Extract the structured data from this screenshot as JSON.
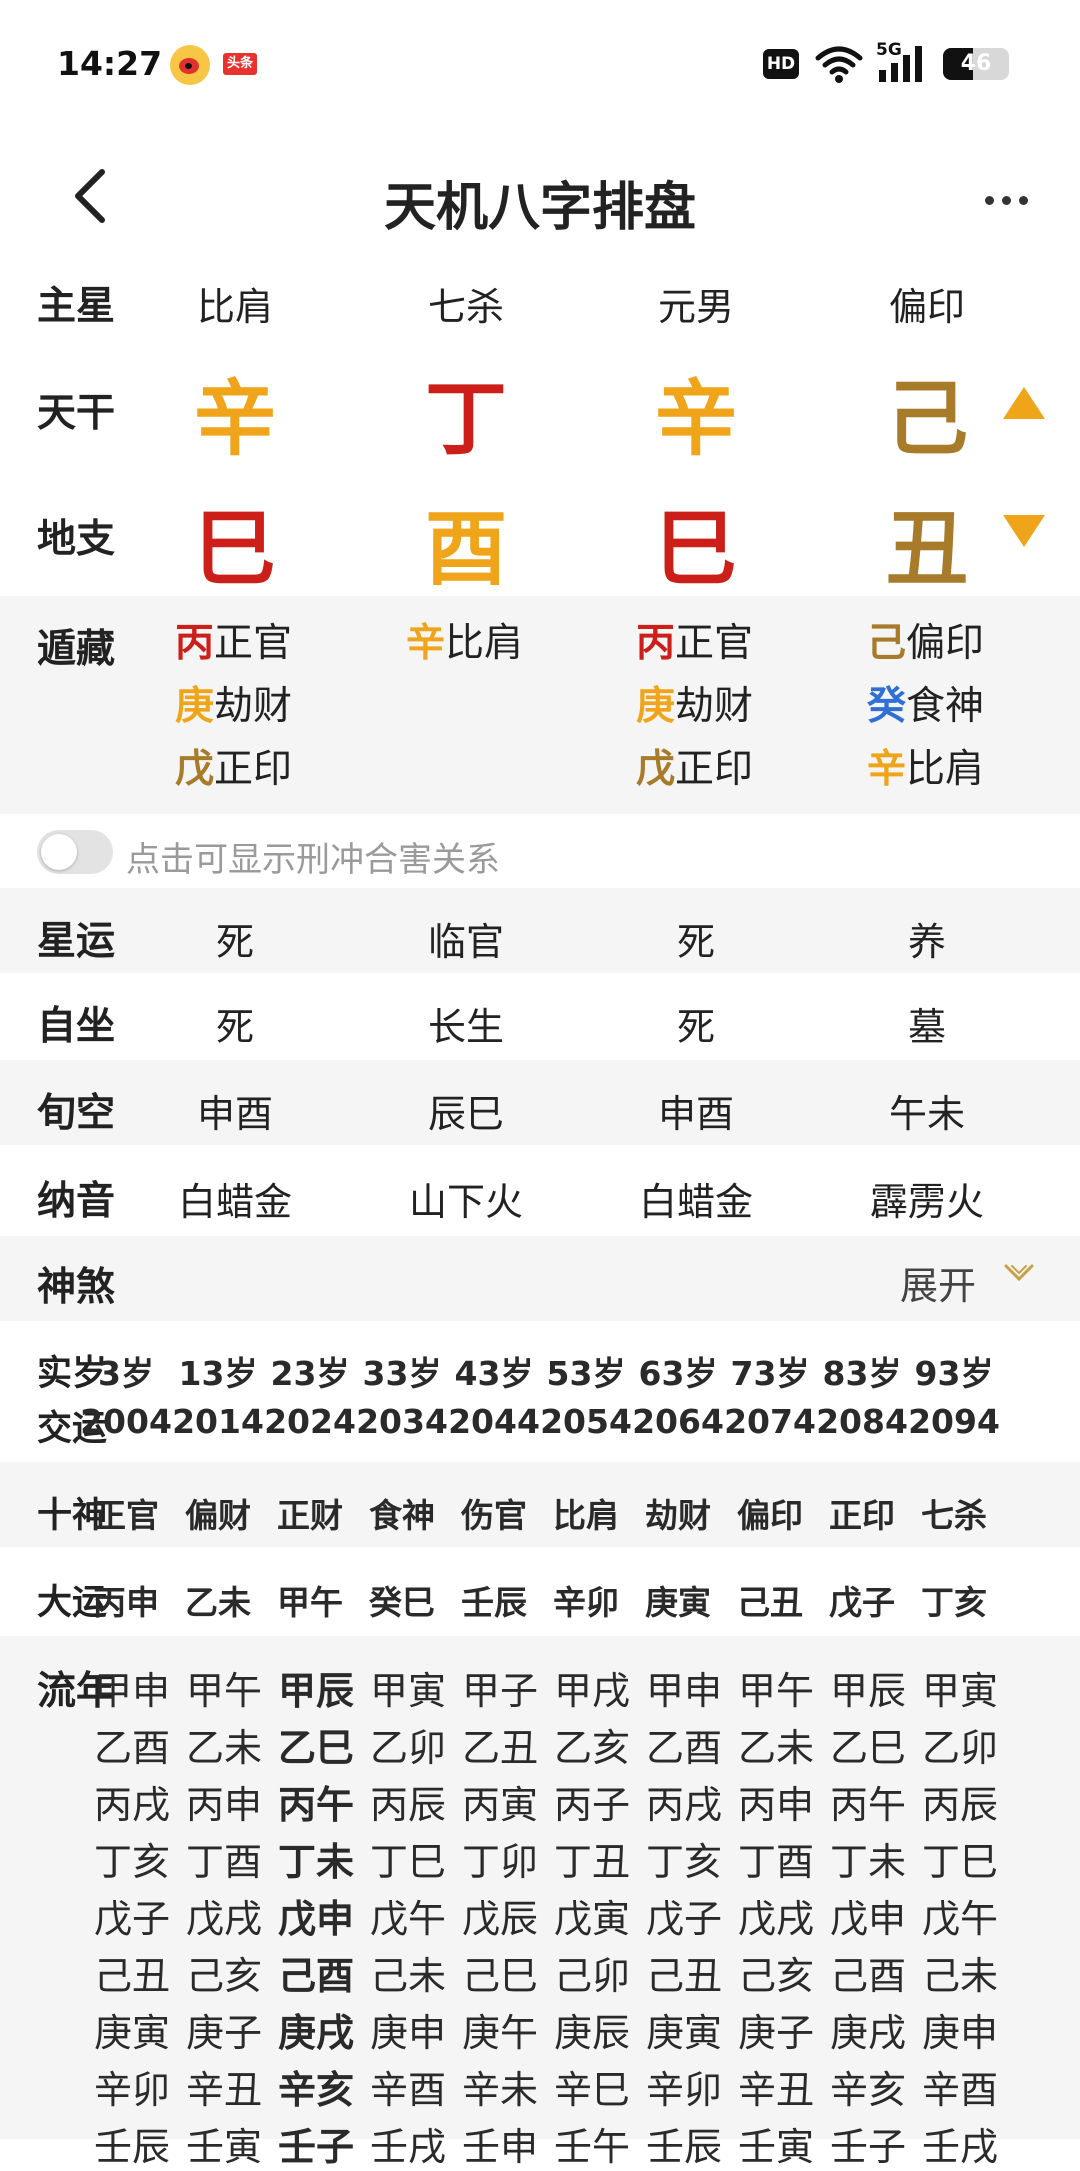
{
  "status": {
    "time": "14:27",
    "toutiao": "头条",
    "hd": "HD",
    "network": "5G",
    "battery_level": "46",
    "battery_fraction": 0.46
  },
  "nav": {
    "title": "天机八字排盘",
    "back_icon": "chevron-left-icon",
    "more_icon": "more-dots-icon"
  },
  "colors": {
    "red": "#cc1f1a",
    "orange": "#f0a419",
    "brown": "#a77b2a",
    "blue": "#2f6fd6",
    "band": "#f5f5f5"
  },
  "labels": {
    "zhuxing": "主星",
    "tiangan": "天干",
    "dizhi": "地支",
    "canggan": "遁藏",
    "xingyun": "星运",
    "zizuo": "自坐",
    "xunkong": "旬空",
    "nayin": "纳音",
    "shensha": "神煞",
    "shisui": "实岁",
    "jiaoyun": "交运",
    "shishen": "十神",
    "dayun": "大运",
    "liunian": "流年"
  },
  "zhuxing": [
    "比肩",
    "七杀",
    "元男",
    "偏印"
  ],
  "tiangan": [
    {
      "char": "辛",
      "color": "orange"
    },
    {
      "char": "丁",
      "color": "red"
    },
    {
      "char": "辛",
      "color": "orange"
    },
    {
      "char": "己",
      "color": "brown"
    }
  ],
  "dizhi": [
    {
      "char": "巳",
      "color": "red"
    },
    {
      "char": "酉",
      "color": "orange"
    },
    {
      "char": "巳",
      "color": "red"
    },
    {
      "char": "丑",
      "color": "brown"
    }
  ],
  "canggan": [
    [
      {
        "stem": "丙",
        "color": "red",
        "god": "正官"
      },
      {
        "stem": "庚",
        "color": "orange",
        "god": "劫财"
      },
      {
        "stem": "戊",
        "color": "brown",
        "god": "正印"
      }
    ],
    [
      {
        "stem": "辛",
        "color": "orange",
        "god": "比肩"
      }
    ],
    [
      {
        "stem": "丙",
        "color": "red",
        "god": "正官"
      },
      {
        "stem": "庚",
        "color": "orange",
        "god": "劫财"
      },
      {
        "stem": "戊",
        "color": "brown",
        "god": "正印"
      }
    ],
    [
      {
        "stem": "己",
        "color": "brown",
        "god": "偏印"
      },
      {
        "stem": "癸",
        "color": "blue",
        "god": "食神"
      },
      {
        "stem": "辛",
        "color": "orange",
        "god": "比肩"
      }
    ]
  ],
  "toggle": {
    "label": "点击可显示刑冲合害关系",
    "on": false
  },
  "xingyun": [
    "死",
    "临官",
    "死",
    "养"
  ],
  "zizuo": [
    "死",
    "长生",
    "死",
    "墓"
  ],
  "xunkong": [
    "申酉",
    "辰巳",
    "申酉",
    "午未"
  ],
  "nayin": [
    "白蜡金",
    "山下火",
    "白蜡金",
    "霹雳火"
  ],
  "shensha": {
    "expand_label": "展开",
    "icon": "chevron-down-icon"
  },
  "shisui": [
    "3岁",
    "13岁",
    "23岁",
    "33岁",
    "43岁",
    "53岁",
    "63岁",
    "73岁",
    "83岁",
    "93岁"
  ],
  "jiaoyun": [
    "2004",
    "2014",
    "2024",
    "2034",
    "2044",
    "2054",
    "2064",
    "2074",
    "2084",
    "2094"
  ],
  "shishen": [
    "正官",
    "偏财",
    "正财",
    "食神",
    "伤官",
    "比肩",
    "劫财",
    "偏印",
    "正印",
    "七杀"
  ],
  "dayun": [
    "丙申",
    "乙未",
    "甲午",
    "癸巳",
    "壬辰",
    "辛卯",
    "庚寅",
    "己丑",
    "戊子",
    "丁亥"
  ],
  "liunian_current_col": 2,
  "liunian": [
    [
      "甲申",
      "甲午",
      "甲辰",
      "甲寅",
      "甲子",
      "甲戌",
      "甲申",
      "甲午",
      "甲辰",
      "甲寅"
    ],
    [
      "乙酉",
      "乙未",
      "乙巳",
      "乙卯",
      "乙丑",
      "乙亥",
      "乙酉",
      "乙未",
      "乙巳",
      "乙卯"
    ],
    [
      "丙戌",
      "丙申",
      "丙午",
      "丙辰",
      "丙寅",
      "丙子",
      "丙戌",
      "丙申",
      "丙午",
      "丙辰"
    ],
    [
      "丁亥",
      "丁酉",
      "丁未",
      "丁巳",
      "丁卯",
      "丁丑",
      "丁亥",
      "丁酉",
      "丁未",
      "丁巳"
    ],
    [
      "戊子",
      "戊戌",
      "戊申",
      "戊午",
      "戊辰",
      "戊寅",
      "戊子",
      "戊戌",
      "戊申",
      "戊午"
    ],
    [
      "己丑",
      "己亥",
      "己酉",
      "己未",
      "己巳",
      "己卯",
      "己丑",
      "己亥",
      "己酉",
      "己未"
    ],
    [
      "庚寅",
      "庚子",
      "庚戌",
      "庚申",
      "庚午",
      "庚辰",
      "庚寅",
      "庚子",
      "庚戌",
      "庚申"
    ],
    [
      "辛卯",
      "辛丑",
      "辛亥",
      "辛酉",
      "辛未",
      "辛巳",
      "辛卯",
      "辛丑",
      "辛亥",
      "辛酉"
    ],
    [
      "壬辰",
      "壬寅",
      "壬子",
      "壬戌",
      "壬申",
      "壬午",
      "壬辰",
      "壬寅",
      "壬子",
      "壬戌"
    ]
  ]
}
